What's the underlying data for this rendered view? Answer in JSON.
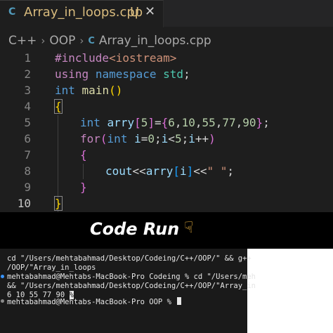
{
  "tab": {
    "icon": "C",
    "label": "Array_in_loops.cpp",
    "status": "U",
    "close": "✕"
  },
  "breadcrumb": {
    "item1": "C++",
    "item2": "OOP",
    "icon": "C",
    "item3": "Array_in_loops.cpp",
    "sep": "›"
  },
  "line_numbers": [
    "1",
    "2",
    "3",
    "4",
    "5",
    "6",
    "7",
    "8",
    "9",
    "10"
  ],
  "code": {
    "l1_a": "#include",
    "l1_b": "<iostream>",
    "l2_a": "using",
    "l2_b": "namespace",
    "l2_c": "std",
    "l3_a": "int",
    "l3_b": "main",
    "l4": "{",
    "l5_a": "int",
    "l5_b": "arry",
    "l5_c": "5",
    "l5_d": "6",
    "l5_e": "10",
    "l5_f": "55",
    "l5_g": "77",
    "l5_h": "90",
    "l6_a": "for",
    "l6_b": "int",
    "l6_c": "i",
    "l6_d": "0",
    "l6_e": "i",
    "l6_f": "5",
    "l6_g": "i",
    "l7": "{",
    "l8_a": "cout",
    "l8_b": "arry",
    "l8_c": "i",
    "l8_d": "\" \"",
    "l9": "}",
    "l10": "}"
  },
  "caption": {
    "text": "Code Run",
    "icon": "☟"
  },
  "terminal": {
    "line1": "cd \"/Users/mehtabahmad/Desktop/Codeing/C++/OOP/\" && g++",
    "line2": "/OOP/\"Array_in_loops",
    "line3": "mehtabahmad@Mehtabs-MacBook-Pro Codeing % cd \"/Users/meh",
    "line4": "&& \"/Users/mehtabahmad/Desktop/Codeing/C++/OOP/\"Array_in",
    "line5_text": "6 10 55 77 90 ",
    "line5_mark": "%",
    "line6": "mehtabahmad@Mehtabs-MacBook-Pro OOP % "
  }
}
